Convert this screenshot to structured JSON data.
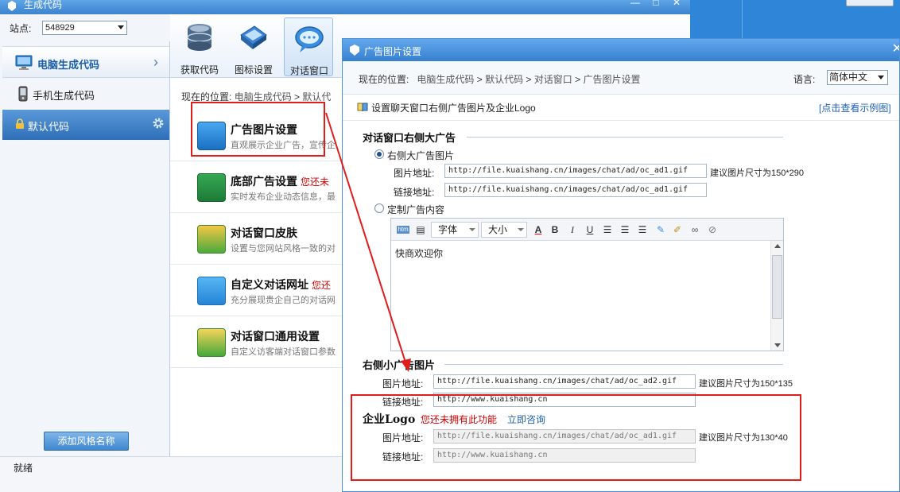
{
  "main_window": {
    "title": "生成代码",
    "site_label": "站点:",
    "site_value": "548929"
  },
  "sidebar": {
    "items": [
      {
        "label": "电脑生成代码"
      },
      {
        "label": "手机生成代码"
      },
      {
        "label": "默认代码"
      }
    ],
    "add_button": "添加风格名称"
  },
  "toolbar": {
    "buttons": [
      {
        "label": "获取代码"
      },
      {
        "label": "图标设置"
      },
      {
        "label": "对话窗口"
      }
    ]
  },
  "main_breadcrumb": {
    "prefix": "现在的位置:",
    "items": [
      "电脑生成代码",
      "默认代"
    ]
  },
  "features": [
    {
      "title": "广告图片设置",
      "desc": "直观展示企业广告，宣传企",
      "warn": ""
    },
    {
      "title": "底部广告设置",
      "desc": "实时发布企业动态信息，最",
      "warn": "您还未"
    },
    {
      "title": "对话窗口皮肤",
      "desc": "设置与您网站风格一致的对",
      "warn": ""
    },
    {
      "title": "自定义对话网址",
      "desc": "充分展现贵企自己的对话网",
      "warn": "您还"
    },
    {
      "title": "对话窗口通用设置",
      "desc": "自定义访客端对话窗口参数",
      "warn": ""
    }
  ],
  "status": "就绪",
  "dialog": {
    "title": "广告图片设置",
    "crumb_prefix": "现在的位置:",
    "crumbs": [
      "电脑生成代码",
      "默认代码",
      "对话窗口",
      "广告图片设置"
    ],
    "lang_label": "语言:",
    "lang_value": "简体中文",
    "intro": "设置聊天窗口右侧广告图片及企业Logo",
    "example_link": "[点击查看示例图]",
    "big_ad": {
      "heading": "对话窗口右侧大广告",
      "radio_image": "右侧大广告图片",
      "image_label": "图片地址:",
      "image_url": "http://file.kuaishang.cn/images/chat/ad/oc_ad1.gif",
      "size_hint": "建议图片尺寸为150*290",
      "link_label": "链接地址:",
      "link_url": "http://file.kuaishang.cn/images/chat/ad/oc_ad1.gif",
      "radio_custom": "定制广告内容"
    },
    "editor": {
      "font_label": "字体",
      "size_label": "大小",
      "content": "快商欢迎你"
    },
    "small_ad": {
      "heading": "右侧小广告图片",
      "image_label": "图片地址:",
      "image_url": "http://file.kuaishang.cn/images/chat/ad/oc_ad2.gif",
      "size_hint": "建议图片尺寸为150*135",
      "link_label": "链接地址:",
      "link_url": "http://www.kuaishang.cn"
    },
    "logo": {
      "heading": "企业Logo",
      "warning": "您还未拥有此功能",
      "consult": "立即咨询",
      "image_label": "图片地址:",
      "image_url": "http://file.kuaishang.cn/images/chat/ad/oc_ad1.gif",
      "size_hint": "建议图片尺寸为130*40",
      "link_label": "链接地址:",
      "link_url": "http://www.kuaishang.cn"
    }
  },
  "colors": {
    "accent": "#3680cf",
    "annotation": "#e21b1b",
    "warning": "#cc0000",
    "link": "#1f62b3"
  }
}
